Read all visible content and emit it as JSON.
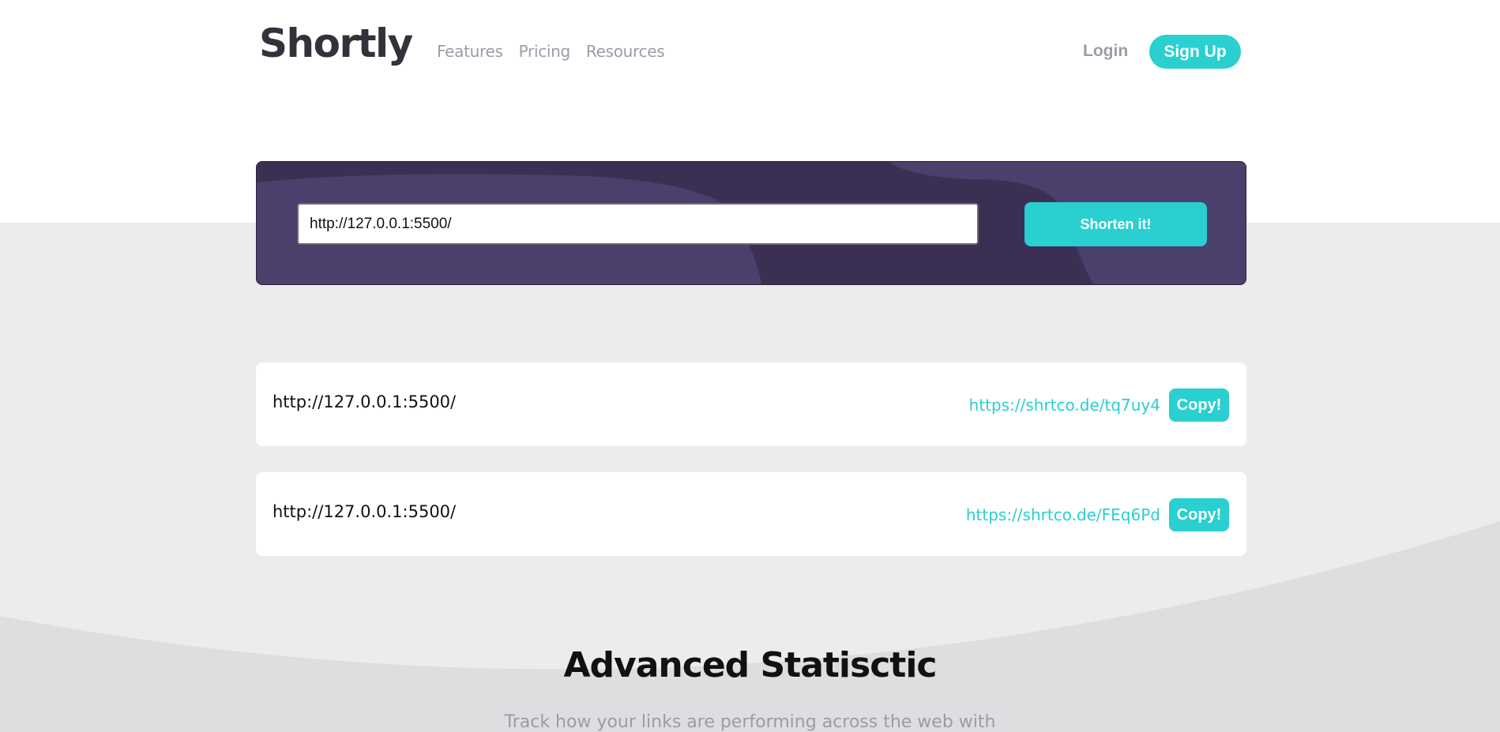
{
  "header": {
    "logo": "Shortly",
    "nav": [
      "Features",
      "Pricing",
      "Resources"
    ],
    "login_label": "Login",
    "signup_label": "Sign Up"
  },
  "shorten": {
    "input_value": "http://127.0.0.1:5500/",
    "button_label": "Shorten it!"
  },
  "results": [
    {
      "original": "http://127.0.0.1:5500/",
      "short": "https://shrtco.de/tq7uy4",
      "copy_label": "Copy!"
    },
    {
      "original": "http://127.0.0.1:5500/",
      "short": "https://shrtco.de/FEq6Pd",
      "copy_label": "Copy!"
    }
  ],
  "stats": {
    "title": "Advanced Statisctic",
    "subtitle": "Track how your links are performing across the web with"
  },
  "colors": {
    "accent": "#2acfcf",
    "banner": "#3b3054",
    "dark_text": "#34313d",
    "muted_text": "#9e9aa7",
    "background_gray": "#ececec"
  }
}
